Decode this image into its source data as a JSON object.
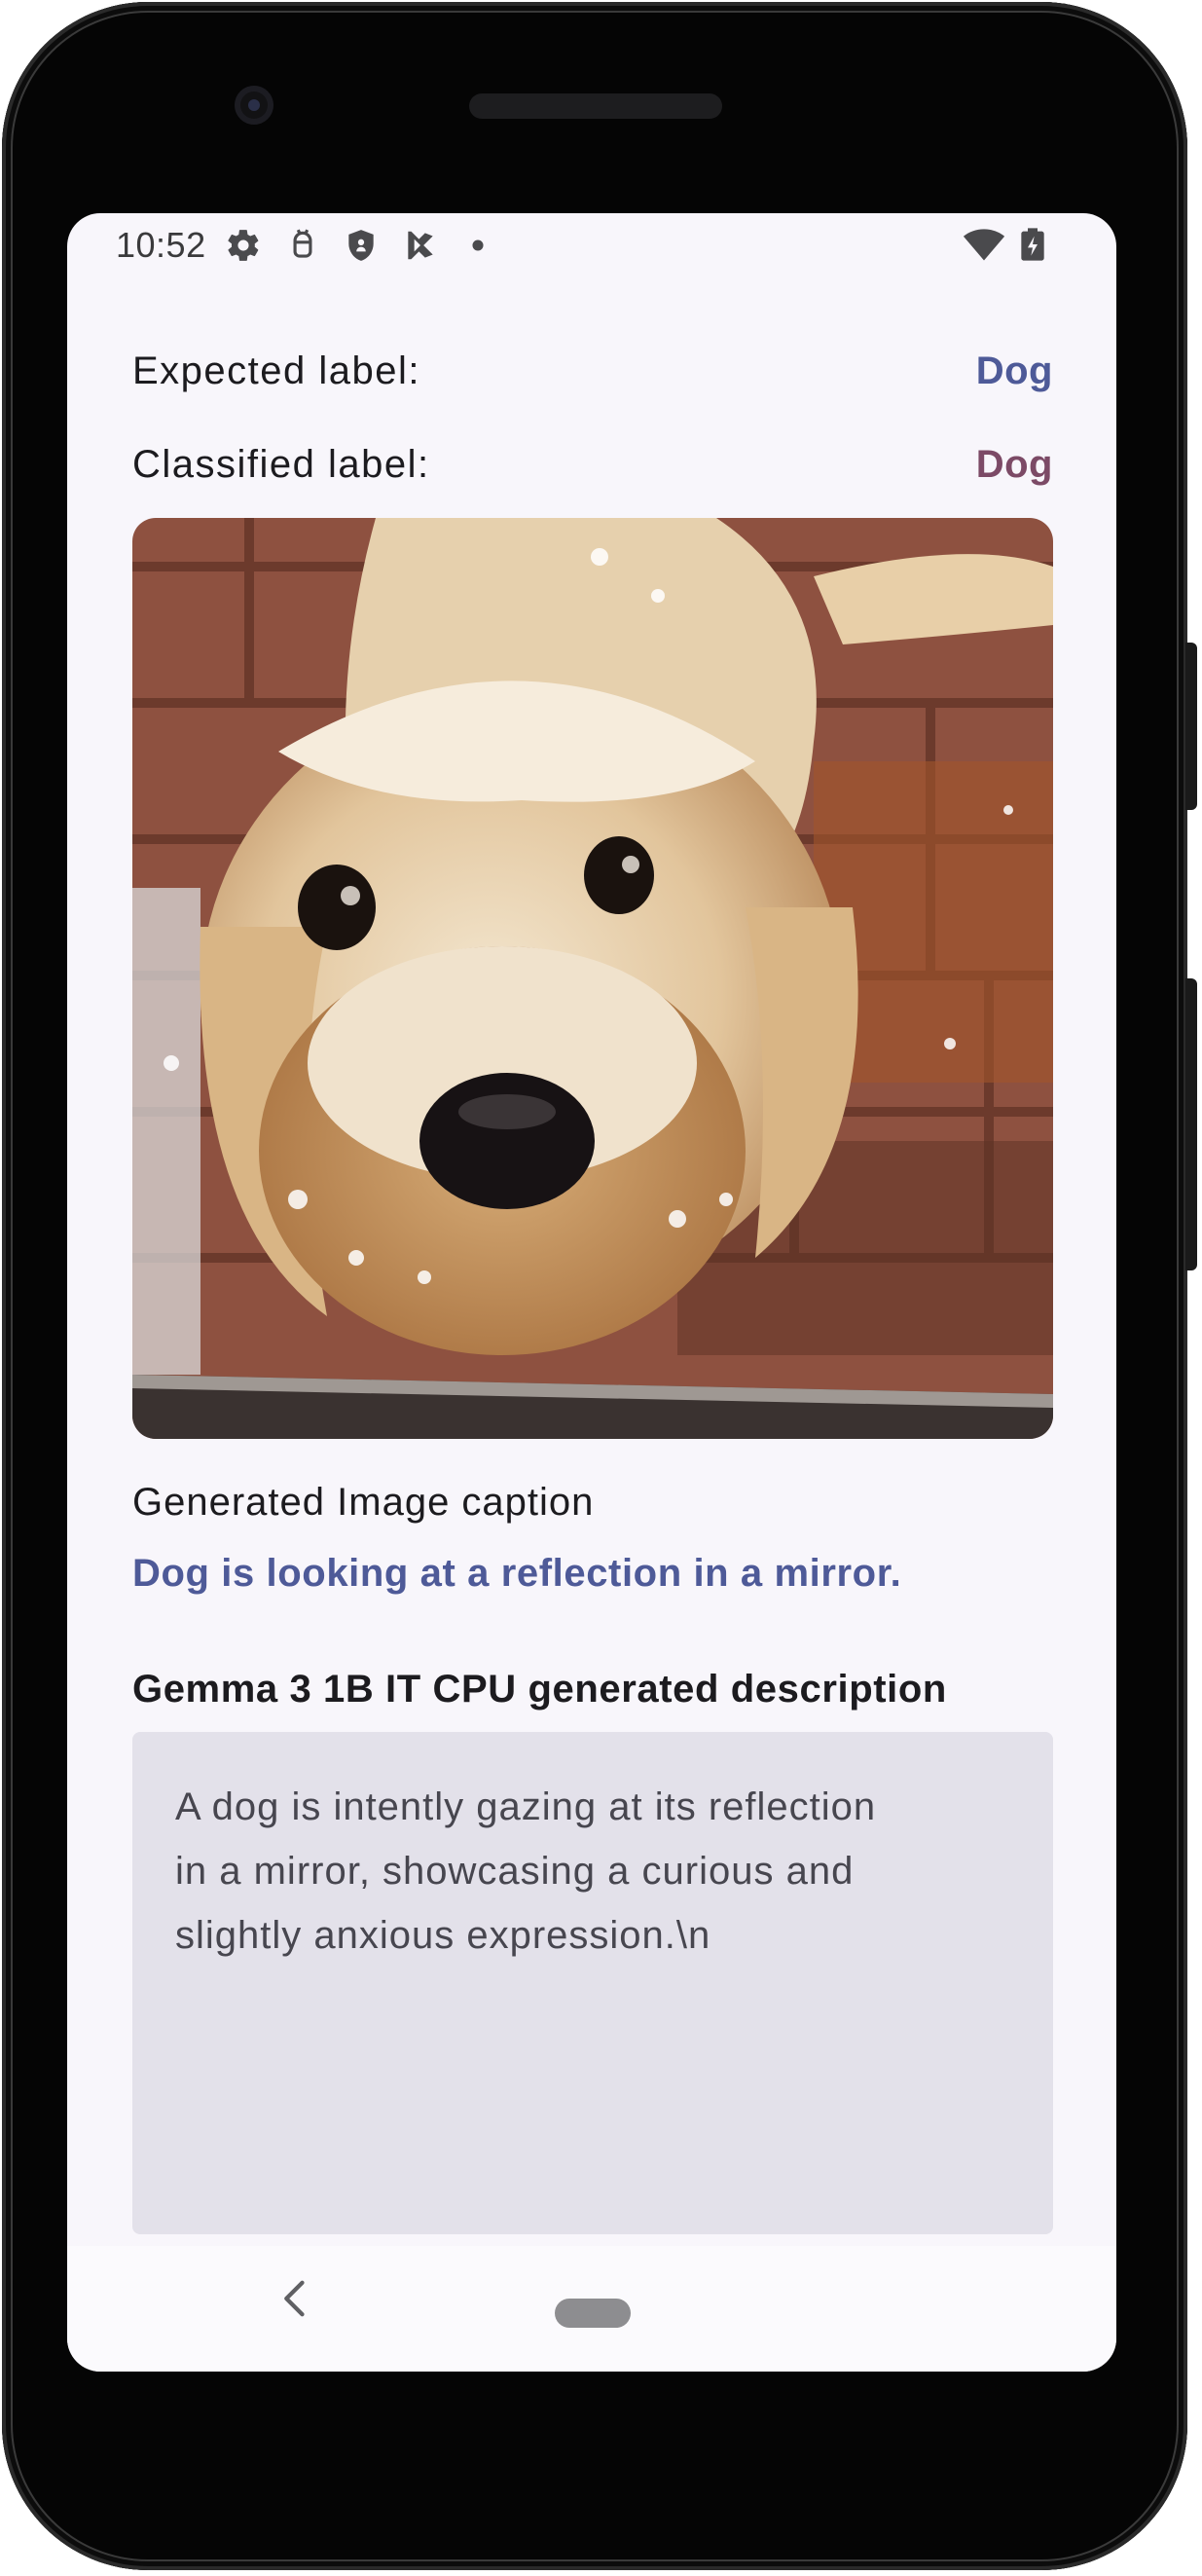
{
  "status_bar": {
    "time": "10:52",
    "icons": [
      "gear-icon",
      "notification-icon",
      "shield-icon",
      "play-store-icon",
      "dot-icon"
    ],
    "right_icons": [
      "wifi-icon",
      "battery-charging-icon"
    ]
  },
  "labels": {
    "expected_label": "Expected label:",
    "expected_value": "Dog",
    "classified_label": "Classified label:",
    "classified_value": "Dog"
  },
  "colors": {
    "expected_value": "#4e5a98",
    "classified_value": "#7c4a66",
    "caption_text": "#4e5a98"
  },
  "image": {
    "subject": "dog-photo"
  },
  "caption": {
    "heading": "Generated Image caption",
    "text": "Dog is looking at a reflection in a mirror."
  },
  "gemma": {
    "heading": "Gemma 3 1B IT CPU generated description",
    "description": "A dog is intently gazing at its reflection\nin a mirror, showcasing a curious and\nslightly anxious expression.\\n"
  },
  "nav": {
    "back_icon": "chevron-left-icon",
    "home_icon": "home-pill-icon"
  }
}
